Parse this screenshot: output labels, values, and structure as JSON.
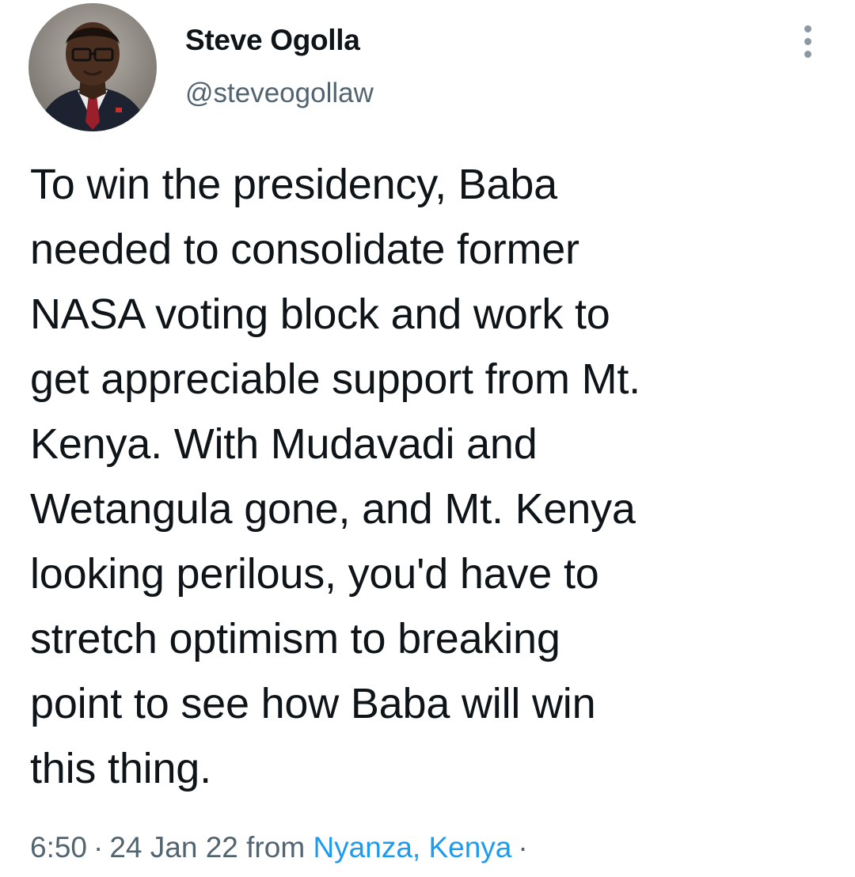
{
  "author": {
    "display_name": "Steve Ogolla",
    "handle": "@steveogollaw",
    "avatar_icon": "profile-photo"
  },
  "more_icon": "more-vertical-icon",
  "tweet": {
    "text": "To win the presidency, Baba\nneeded to consolidate former\nNASA voting block and work to\nget appreciable support from Mt.\nKenya. With Mudavadi and\nWetangula gone, and Mt. Kenya\nlooking perilous, you'd have to\nstretch optimism to breaking\npoint to see how Baba will win\nthis thing."
  },
  "meta": {
    "time": "6:50",
    "separator": "·",
    "date": "24 Jan 22",
    "from_label": "from",
    "location": "Nyanza, Kenya",
    "trailing_separator": "·"
  },
  "colors": {
    "text_primary": "#0f1419",
    "text_secondary": "#536471",
    "link": "#1d9bf0",
    "icon_gray": "#8b98a5"
  }
}
